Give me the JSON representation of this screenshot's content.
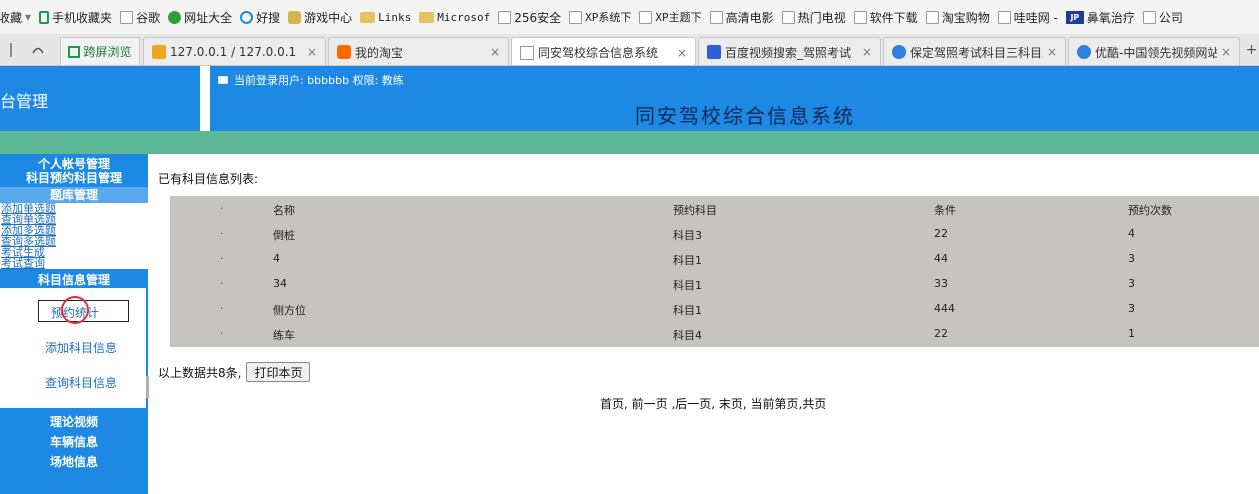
{
  "bookmarks": [
    {
      "label": "收藏",
      "icon": "none"
    },
    {
      "label": "手机收藏夹",
      "icon": "phone-icon"
    },
    {
      "label": "谷歌",
      "icon": "page-icon"
    },
    {
      "label": "网址大全",
      "icon": "globe-icon"
    },
    {
      "label": "好搜",
      "icon": "search-icon"
    },
    {
      "label": "游戏中心",
      "icon": "game-icon"
    },
    {
      "label": "Links",
      "icon": "folder-icon"
    },
    {
      "label": "Microsof",
      "icon": "folder-icon"
    },
    {
      "label": "256安全",
      "icon": "page-icon"
    },
    {
      "label": "XP系统下",
      "icon": "page-icon"
    },
    {
      "label": "XP主题下",
      "icon": "page-icon"
    },
    {
      "label": "高清电影",
      "icon": "page-icon"
    },
    {
      "label": "热门电视",
      "icon": "page-icon"
    },
    {
      "label": "软件下载",
      "icon": "page-icon"
    },
    {
      "label": "淘宝购物",
      "icon": "page-icon"
    },
    {
      "label": "哇哇网 -",
      "icon": "page-icon"
    },
    {
      "label": "鼻氧治疗",
      "icon": "jp-icon",
      "badge": "JP"
    },
    {
      "label": "公司",
      "icon": "page-icon"
    }
  ],
  "tabbar": {
    "split_label": "跨屏浏览",
    "tabs": [
      {
        "title": "127.0.0.1 / 127.0.0.1",
        "icon": "pma-icon",
        "active": false
      },
      {
        "title": "我的淘宝",
        "icon": "taobao-icon",
        "active": false
      },
      {
        "title": "同安驾校综合信息系统",
        "icon": "page-icon",
        "active": true
      },
      {
        "title": "百度视频搜索_驾照考试",
        "icon": "baidu-icon",
        "active": false
      },
      {
        "title": "保定驾照考试科目三科目三",
        "icon": "play-icon",
        "active": false
      },
      {
        "title": "优酷-中国领先视频网站,",
        "icon": "play-icon",
        "active": false
      }
    ],
    "close_glyph": "×",
    "new_tab_glyph": "+"
  },
  "header": {
    "left_title": "台管理",
    "login_text": "当前登录用户: bbbbbb 权限: 教练",
    "system_title": "同安驾校综合信息系统"
  },
  "sidebar": {
    "personal_account": "个人帐号管理",
    "subject_booking": "科目预约科目管理",
    "question_bank": "题库管理",
    "question_links": [
      "添加单选题",
      "查询单选题",
      "添加多选题",
      "查询多选题",
      "考试生成",
      "考试查询"
    ],
    "subject_info": "科目信息管理",
    "booking_stats": "预约统计",
    "add_subject": "添加科目信息",
    "query_subject": "查询科目信息",
    "theory_video": "理论视频",
    "vehicle_info": "车辆信息",
    "site_info": "场地信息"
  },
  "main": {
    "list_caption": "已有科目信息列表:",
    "table": {
      "columns": [
        "名称",
        "预约科目",
        "条件",
        "预约次数"
      ],
      "bullet": "·",
      "rows": [
        [
          "倒桩",
          "科目3",
          "22",
          "4"
        ],
        [
          "4",
          "科目1",
          "44",
          "3"
        ],
        [
          "34",
          "科目1",
          "33",
          "3"
        ],
        [
          "侧方位",
          "科目1",
          "444",
          "3"
        ],
        [
          "练车",
          "科目4",
          "22",
          "1"
        ]
      ]
    },
    "summary_text": "以上数据共8条,",
    "print_button": "打印本页",
    "pager_text": "首页, 前一页 ,后一页, 末页, 当前第页,共页"
  },
  "colors": {
    "header_blue": "#1e88e5",
    "title_navy": "#0b2a55",
    "green_bar": "#5cb896",
    "table_gray": "#c6c3c3",
    "highlight_circle": "#e03030"
  }
}
